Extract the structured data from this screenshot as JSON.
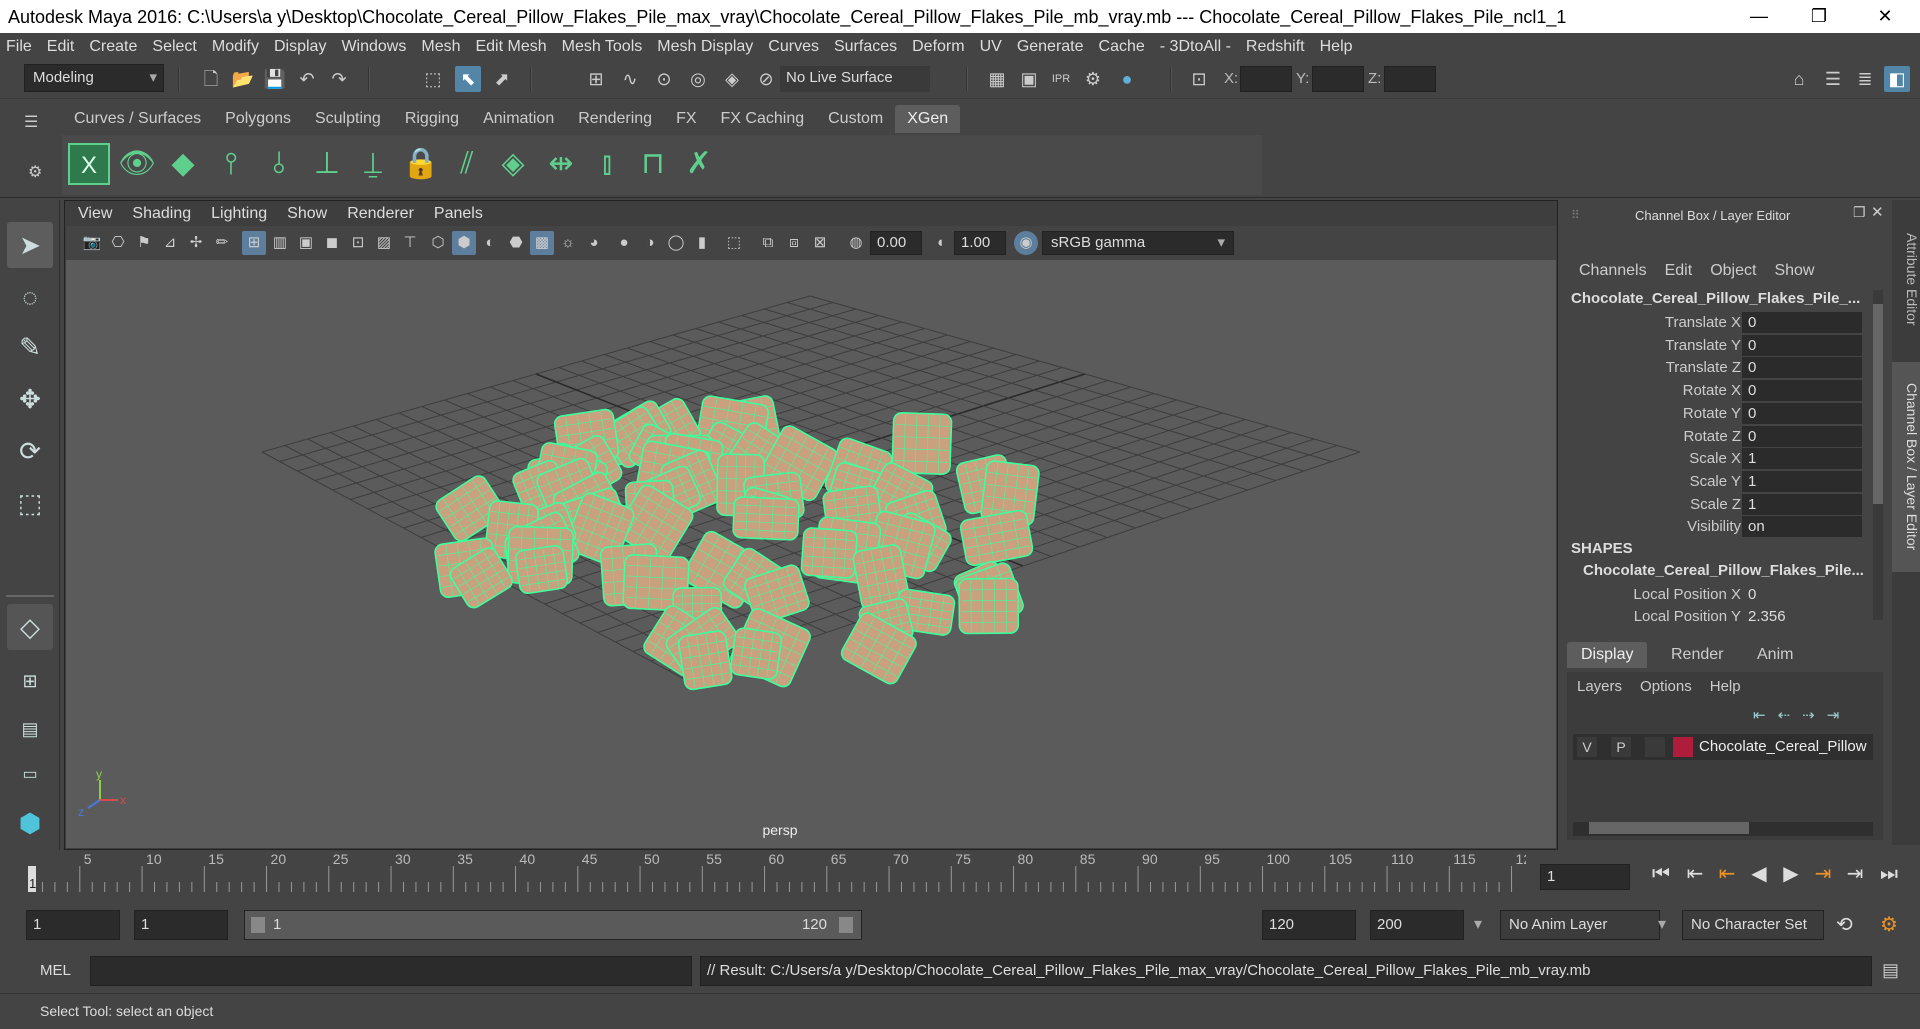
{
  "window": {
    "title": "Autodesk Maya 2016: C:\\Users\\a y\\Desktop\\Chocolate_Cereal_Pillow_Flakes_Pile_max_vray\\Chocolate_Cereal_Pillow_Flakes_Pile_mb_vray.mb   ---   Chocolate_Cereal_Pillow_Flakes_Pile_ncl1_1",
    "minimize": "—",
    "restore": "❐",
    "close": "✕"
  },
  "menubar": [
    "File",
    "Edit",
    "Create",
    "Select",
    "Modify",
    "Display",
    "Windows",
    "Mesh",
    "Edit Mesh",
    "Mesh Tools",
    "Mesh Display",
    "Curves",
    "Surfaces",
    "Deform",
    "UV",
    "Generate",
    "Cache",
    "- 3DtoAll -",
    "Redshift",
    "Help"
  ],
  "statusline": {
    "mode": "Modeling",
    "live_surface": "No Live Surface",
    "x_label": "X:",
    "y_label": "Y:",
    "z_label": "Z:",
    "x_value": "",
    "y_value": "",
    "z_value": ""
  },
  "shelf": {
    "tabs": [
      "Curves / Surfaces",
      "Polygons",
      "Sculpting",
      "Rigging",
      "Animation",
      "Rendering",
      "FX",
      "FX Caching",
      "Custom",
      "XGen"
    ],
    "active_tab": "XGen"
  },
  "viewport": {
    "menu": [
      "View",
      "Shading",
      "Lighting",
      "Show",
      "Renderer",
      "Panels"
    ],
    "exposure": "0.00",
    "gamma": "1.00",
    "color_space": "sRGB gamma",
    "camera_label": "persp",
    "axis_x": "x",
    "axis_y": "y",
    "axis_z": "z"
  },
  "channel_box": {
    "title": "Channel Box / Layer Editor",
    "menu": [
      "Channels",
      "Edit",
      "Object",
      "Show"
    ],
    "object_name": "Chocolate_Cereal_Pillow_Flakes_Pile_...",
    "attributes": [
      {
        "name": "Translate X",
        "value": "0"
      },
      {
        "name": "Translate Y",
        "value": "0"
      },
      {
        "name": "Translate Z",
        "value": "0"
      },
      {
        "name": "Rotate X",
        "value": "0"
      },
      {
        "name": "Rotate Y",
        "value": "0"
      },
      {
        "name": "Rotate Z",
        "value": "0"
      },
      {
        "name": "Scale X",
        "value": "1"
      },
      {
        "name": "Scale Y",
        "value": "1"
      },
      {
        "name": "Scale Z",
        "value": "1"
      },
      {
        "name": "Visibility",
        "value": "on"
      }
    ],
    "shapes_header": "SHAPES",
    "shape_name": "Chocolate_Cereal_Pillow_Flakes_Pile...",
    "shape_attributes": [
      {
        "name": "Local Position X",
        "value": "0"
      },
      {
        "name": "Local Position Y",
        "value": "2.356"
      }
    ]
  },
  "layer_editor": {
    "tabs": [
      "Display",
      "Render",
      "Anim"
    ],
    "active_tab": "Display",
    "menu": [
      "Layers",
      "Options",
      "Help"
    ],
    "layer": {
      "v": "V",
      "p": "P",
      "name": "Chocolate_Cereal_Pillow",
      "color": "#b01d3c"
    }
  },
  "side_tabs": [
    "Attribute Editor",
    "Channel Box / Layer Editor"
  ],
  "timeline": {
    "ticks": [
      "5",
      "10",
      "15",
      "20",
      "25",
      "30",
      "35",
      "40",
      "45",
      "50",
      "55",
      "60",
      "65",
      "70",
      "75",
      "80",
      "85",
      "90",
      "95",
      "100",
      "105",
      "110",
      "115",
      "12"
    ],
    "current_marker": "1",
    "current_frame": "1"
  },
  "range": {
    "start": "1",
    "playback_start": "1",
    "slider_start": "1",
    "slider_end": "120",
    "playback_end": "120",
    "end": "200",
    "anim_layer": "No Anim Layer",
    "character_set": "No Character Set"
  },
  "command": {
    "label": "MEL",
    "input": "",
    "result": "// Result: C:/Users/a y/Desktop/Chocolate_Cereal_Pillow_Flakes_Pile_max_vray/Chocolate_Cereal_Pillow_Flakes_Pile_mb_vray.mb"
  },
  "help": "Select Tool: select an object",
  "colors": {
    "wireframe": "#3dff9b",
    "pillow": "#c9a17f",
    "accent": "#5285a6",
    "background": "#444444"
  }
}
